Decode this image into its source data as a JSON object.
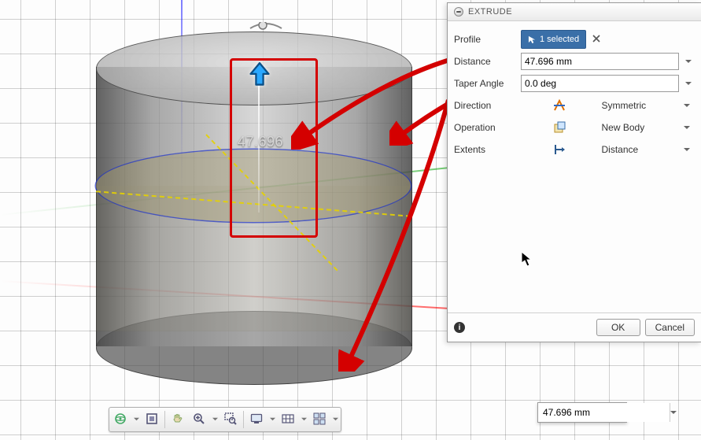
{
  "viewport": {
    "floating_dimension": "47.696"
  },
  "extrude_panel": {
    "title": "EXTRUDE",
    "rows": {
      "profile": {
        "label": "Profile",
        "selection_count": "1 selected"
      },
      "distance": {
        "label": "Distance",
        "value": "47.696 mm"
      },
      "taper": {
        "label": "Taper Angle",
        "value": "0.0 deg"
      },
      "direction": {
        "label": "Direction",
        "value": "Symmetric"
      },
      "operation": {
        "label": "Operation",
        "value": "New Body"
      },
      "extents": {
        "label": "Extents",
        "value": "Distance"
      }
    },
    "buttons": {
      "ok": "OK",
      "cancel": "Cancel"
    }
  },
  "float_input": {
    "value": "47.696 mm"
  },
  "toolbar": {
    "buttons": [
      "orbit",
      "lookat",
      "pan",
      "zoom",
      "zoom-window",
      "display-settings",
      "grid-settings",
      "viewports"
    ]
  }
}
